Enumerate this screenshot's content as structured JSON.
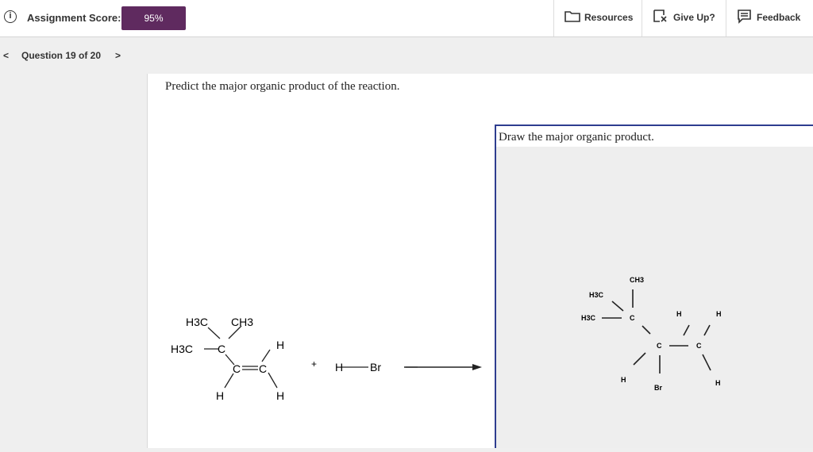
{
  "header": {
    "score_label": "Assignment Score:",
    "score_value": "95%",
    "resources_label": "Resources",
    "giveup_label": "Give Up?",
    "feedback_label": "Feedback"
  },
  "nav": {
    "prev_symbol": "<",
    "question_label": "Question 19 of 20",
    "next_symbol": ">"
  },
  "question": {
    "prompt": "Predict the major organic product of the reaction."
  },
  "reactant": {
    "atoms": [
      "H3C",
      "CH3",
      "H3C",
      "C",
      "H",
      "C",
      "C",
      "H",
      "H"
    ],
    "plus": "+",
    "reagent_h": "H",
    "reagent_br": "Br"
  },
  "draw_area": {
    "header": "Draw the major organic product.",
    "atoms": [
      "CH3",
      "H3C",
      "H3C",
      "C",
      "H",
      "H",
      "C",
      "C",
      "H",
      "Br",
      "H"
    ]
  },
  "colors": {
    "brand": "#5f2a5f",
    "draw_border": "#2e3d8f"
  }
}
